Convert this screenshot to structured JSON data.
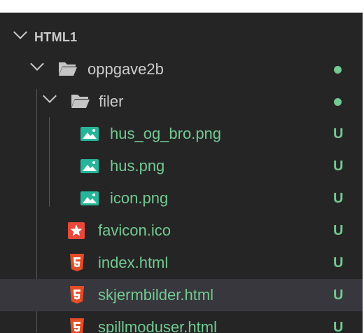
{
  "colors": {
    "panel_bg": "#252526",
    "selected_bg": "#37373d",
    "text_default": "#cccccc",
    "text_untracked": "#73c991",
    "git_dot": "#73c991",
    "folder_icon": "#c5c5c5",
    "image_icon": "#26b59a",
    "favicon_icon": "#e9493a",
    "html5_icon": "#e44d26"
  },
  "explorer": {
    "root": {
      "label": "HTML1",
      "icon": "chevron-down-icon"
    },
    "items": [
      {
        "label": "oppgave2b",
        "type": "folder",
        "icon": "folder-open-icon",
        "git_status": "dot"
      },
      {
        "label": "filer",
        "type": "folder",
        "icon": "folder-open-icon",
        "git_status": "dot"
      },
      {
        "label": "hus_og_bro.png",
        "type": "file",
        "icon": "image-icon",
        "git_status": "U"
      },
      {
        "label": "hus.png",
        "type": "file",
        "icon": "image-icon",
        "git_status": "U"
      },
      {
        "label": "icon.png",
        "type": "file",
        "icon": "image-icon",
        "git_status": "U"
      },
      {
        "label": "favicon.ico",
        "type": "file",
        "icon": "favicon-star-icon",
        "git_status": "U"
      },
      {
        "label": "index.html",
        "type": "file",
        "icon": "html5-icon",
        "git_status": "U"
      },
      {
        "label": "skjermbilder.html",
        "type": "file",
        "icon": "html5-icon",
        "git_status": "U",
        "selected": true
      },
      {
        "label": "spillmoduser.html",
        "type": "file",
        "icon": "html5-icon",
        "git_status": "U"
      }
    ]
  }
}
